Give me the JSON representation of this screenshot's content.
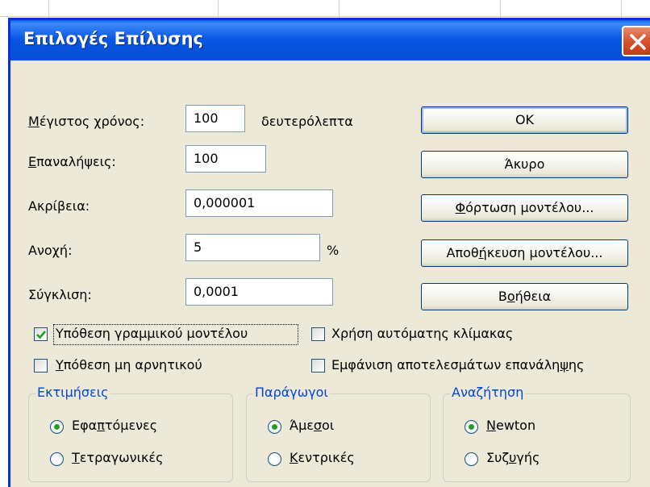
{
  "dialog": {
    "title": "Επιλογές Επίλυσης"
  },
  "fields": {
    "max_time": {
      "label_u": "Μ",
      "label_rest": "έγιστος χρόνος:",
      "value": "100",
      "unit": "δευτερόλεπτα"
    },
    "iterations": {
      "label_u": "Ε",
      "label_rest": "παναλήψεις:",
      "value": "100"
    },
    "precision": {
      "label": "Ακρίβεια:",
      "value": "0,000001"
    },
    "tolerance": {
      "label_pre": "Ανο",
      "label_u": "χ",
      "label_post": "ή:",
      "value": "5",
      "unit": "%"
    },
    "convergence": {
      "label": "Σύγκλιση:",
      "value": "0,0001"
    }
  },
  "buttons": {
    "ok": "OK",
    "cancel": "Άκυρο",
    "load_pre": "",
    "load_u": "Φ",
    "load_post": "όρτωση μοντέλου...",
    "save_pre": "Αποθ",
    "save_u": "ή",
    "save_post": "κευση μοντέλου...",
    "help_pre": "Β",
    "help_u": "ο",
    "help_post": "ήθεια"
  },
  "checkboxes": {
    "linear_model": {
      "label": "Υπόθεση γραμμικού μοντέλου",
      "checked": true
    },
    "auto_scaling": {
      "label": "Χρήση αυτόματης κλίμακας",
      "checked": false
    },
    "non_negative": {
      "label_u": "Υ",
      "label_rest": "πόθεση μη αρνητικού",
      "checked": false
    },
    "show_iteration": {
      "label_pre": "Εμφάνιση αποτελεσμάτων επανάλη",
      "label_u": "ψ",
      "label_post": "ης",
      "checked": false
    }
  },
  "groups": {
    "estimates": {
      "title": "Εκτιμήσεις",
      "options": [
        {
          "pre": "Εφα",
          "u": "π",
          "post": "τόμενες",
          "selected": true
        },
        {
          "pre": "",
          "u": "Τ",
          "post": "ετραγωνικές",
          "selected": false
        }
      ]
    },
    "derivatives": {
      "title": "Παράγωγοι",
      "options": [
        {
          "pre": "Άμε",
          "u": "σ",
          "post": "οι",
          "selected": true
        },
        {
          "pre": "",
          "u": "Κ",
          "post": "εντρικές",
          "selected": false
        }
      ]
    },
    "search": {
      "title": "Αναζήτηση",
      "options": [
        {
          "pre": "",
          "u": "N",
          "post": "ewton",
          "selected": true
        },
        {
          "pre": "Συζ",
          "u": "υ",
          "post": "γής",
          "selected": false
        }
      ]
    }
  },
  "colors": {
    "titlebar": "#0a5fe8",
    "dialog_bg": "#ece9d8",
    "group_title": "#0046d5",
    "radio_dot": "#21a121",
    "checkmark": "#21a121"
  }
}
